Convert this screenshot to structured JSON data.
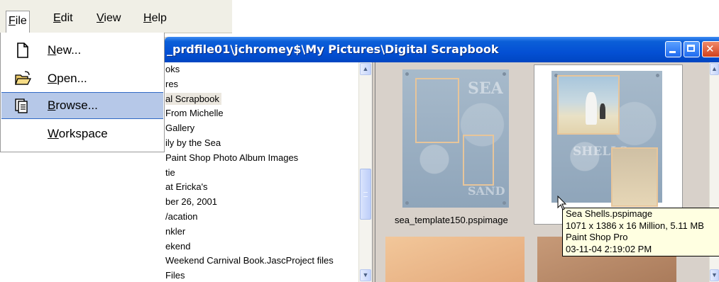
{
  "menubar": {
    "items": [
      {
        "label": "File",
        "accel": "F",
        "rest": "ile"
      },
      {
        "label": "Edit",
        "accel": "E",
        "rest": "dit"
      },
      {
        "label": "View",
        "accel": "V",
        "rest": "iew"
      },
      {
        "label": "Help",
        "accel": "H",
        "rest": "elp"
      }
    ]
  },
  "file_menu": {
    "items": [
      {
        "label": "New...",
        "accel": "N",
        "rest": "ew...",
        "icon": "new-document-icon"
      },
      {
        "label": "Open...",
        "accel": "O",
        "rest": "pen...",
        "icon": "open-folder-icon"
      },
      {
        "label": "Browse...",
        "accel": "B",
        "rest": "rowse...",
        "icon": "browse-icon",
        "highlighted": true
      },
      {
        "label": "Workspace",
        "accel": "W",
        "rest": "orkspace",
        "icon": null
      }
    ]
  },
  "browser": {
    "title": "_prdfile01\\jchromey$\\My Pictures\\Digital Scrapbook",
    "tree": [
      "oks",
      "res",
      "al Scrapbook",
      "From Michelle",
      "Gallery",
      "ily by the Sea",
      " Paint Shop Photo Album Images",
      "tie",
      " at Ericka's",
      "ber 26, 2001",
      "/acation",
      "nkler",
      "ekend",
      "Weekend Carnival Book.JascProject files",
      "Files"
    ],
    "tree_selected_index": 2,
    "thumbnails": [
      {
        "filename": "sea_template150.pspimage"
      },
      {
        "filename": "Sea Shells.pspimage",
        "selected": true
      }
    ],
    "tooltip": {
      "filename": "Sea Shells.pspimage",
      "dimensions": "1071 x 1386 x 16 Million, 5.11 MB",
      "application": "Paint Shop Pro",
      "date": "03-11-04 2:19:02 PM"
    }
  },
  "colors": {
    "titlebar": "#0450d4",
    "menu_highlight": "#b6c8e8",
    "tooltip_bg": "#ffffe1"
  }
}
